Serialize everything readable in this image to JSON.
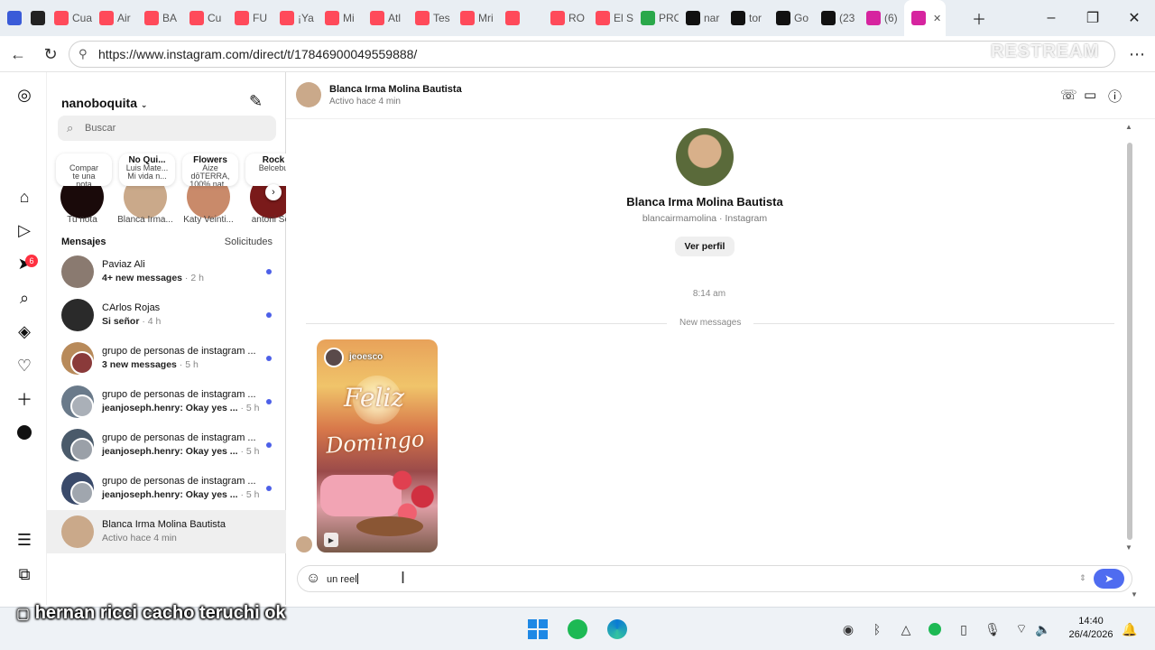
{
  "browser": {
    "tabs": [
      {
        "label": "",
        "icon": "profile-r-icon",
        "color": "#3a5bd8"
      },
      {
        "label": "",
        "icon": "record-icon",
        "color": "#222222"
      },
      {
        "label": "Cua",
        "icon": "youtube-icon",
        "color": "#ff4a5a"
      },
      {
        "label": "Air",
        "icon": "youtube-icon",
        "color": "#ff4a5a"
      },
      {
        "label": "BA",
        "icon": "youtube-icon",
        "color": "#ff4a5a"
      },
      {
        "label": "Cu",
        "icon": "youtube-icon",
        "color": "#ff4a5a"
      },
      {
        "label": "FU",
        "icon": "youtube-icon",
        "color": "#ff4a5a"
      },
      {
        "label": "¡Ya",
        "icon": "youtube-icon",
        "color": "#ff4a5a"
      },
      {
        "label": "Mi",
        "icon": "youtube-icon",
        "color": "#ff4a5a"
      },
      {
        "label": "Atl",
        "icon": "youtube-icon",
        "color": "#ff4a5a"
      },
      {
        "label": "Tes",
        "icon": "youtube-icon",
        "color": "#ff4a5a"
      },
      {
        "label": "Mri",
        "icon": "youtube-icon",
        "color": "#ff4a5a"
      },
      {
        "label": "",
        "icon": "youtube-icon",
        "color": "#ff4a5a"
      },
      {
        "label": "RO",
        "icon": "youtube-icon",
        "color": "#ff4a5a"
      },
      {
        "label": "El S",
        "icon": "youtube-icon",
        "color": "#ff4a5a"
      },
      {
        "label": "PRO",
        "icon": "soccer-icon",
        "color": "#2aa84a"
      },
      {
        "label": "nar",
        "icon": "kick-icon",
        "color": "#111111"
      },
      {
        "label": "tor",
        "icon": "kick-icon",
        "color": "#111111"
      },
      {
        "label": "Go",
        "icon": "kick-icon",
        "color": "#111111"
      },
      {
        "label": "(23",
        "icon": "x-icon",
        "color": "#111111"
      },
      {
        "label": "(6)",
        "icon": "instagram-icon",
        "color": "#d6249f"
      },
      {
        "label": "",
        "icon": "instagram-icon",
        "color": "#d6249f",
        "active": true
      }
    ],
    "url": "https://www.instagram.com/direct/t/17846900049559888/",
    "watermark": "RESTREAM"
  },
  "sidebar": {
    "username": "nanoboquita",
    "search_placeholder": "Buscar",
    "notes": [
      {
        "title": "",
        "line1": "Compar",
        "line2": "te una",
        "line3": "nota",
        "name": "Tu nota",
        "avatar": "#1a0a0a"
      },
      {
        "title": "No Qui...",
        "line1": "Luis Mate...",
        "line2": "Mi vida n...",
        "line3": "",
        "name": "Blanca Irma...",
        "avatar": "#caa98a"
      },
      {
        "title": "Flowers",
        "line1": "Aize",
        "line2": "dōTERRA,",
        "line3": "100% nat...",
        "name": "Katy Veinti...",
        "avatar": "#c98a6a"
      },
      {
        "title": "Rock",
        "line1": "Belcebu",
        "line2": "",
        "line3": "",
        "name": "antoni Sel",
        "avatar": "#7a1a1a"
      }
    ],
    "messages_title": "Mensajes",
    "requests_label": "Solicitudes",
    "conversations": [
      {
        "name": "Paviaz Ali",
        "preview": "4+ new messages",
        "time": " · 2 h",
        "unread": true,
        "avatar": "#8a7a70",
        "avatar2": ""
      },
      {
        "name": "CArlos Rojas",
        "preview": "Si señor",
        "time": " · 4 h",
        "unread": true,
        "avatar": "#2a2a2a",
        "avatar2": ""
      },
      {
        "name": "grupo de personas de instagram ...",
        "preview": "3 new messages",
        "time": " · 5 h",
        "unread": true,
        "avatar": "#b88a5a",
        "avatar2": "#8a3a3a"
      },
      {
        "name": "grupo de personas de instagram ...",
        "preview": "jeanjoseph.henry: Okay yes ...",
        "time": " · 5 h",
        "unread": true,
        "avatar": "#6a7a8a",
        "avatar2": "#aab0b8"
      },
      {
        "name": "grupo de personas de instagram ...",
        "preview": "jeanjoseph.henry: Okay yes ...",
        "time": " · 5 h",
        "unread": true,
        "avatar": "#4a5a6a",
        "avatar2": "#9aa0a8"
      },
      {
        "name": "grupo de personas de instagram ...",
        "preview": "jeanjoseph.henry: Okay yes ...",
        "time": " · 5 h",
        "unread": true,
        "avatar": "#3a4a6a",
        "avatar2": "#a0a6ae"
      },
      {
        "name": "Blanca Irma Molina Bautista",
        "preview": "Activo hace 4 min",
        "time": "",
        "unread": false,
        "selected": true,
        "avatar": "#caa98a",
        "avatar2": ""
      }
    ],
    "notification_count": "6"
  },
  "chat": {
    "name": "Blanca Irma Molina Bautista",
    "status": "Activo hace 4 min",
    "profile_handle": "blancairmamolina · Instagram",
    "view_profile": "Ver perfil",
    "timestamp": "8:14 am",
    "new_messages": "New messages",
    "reel_user": "jeoesco",
    "reel_text1": "Feliz",
    "reel_text2": "Domingo",
    "composer_text": "un reel"
  },
  "overlay_caption": "hernan ricci cacho teruchi ok",
  "taskbar": {
    "time": "14:40",
    "date": "26/4/2026"
  }
}
